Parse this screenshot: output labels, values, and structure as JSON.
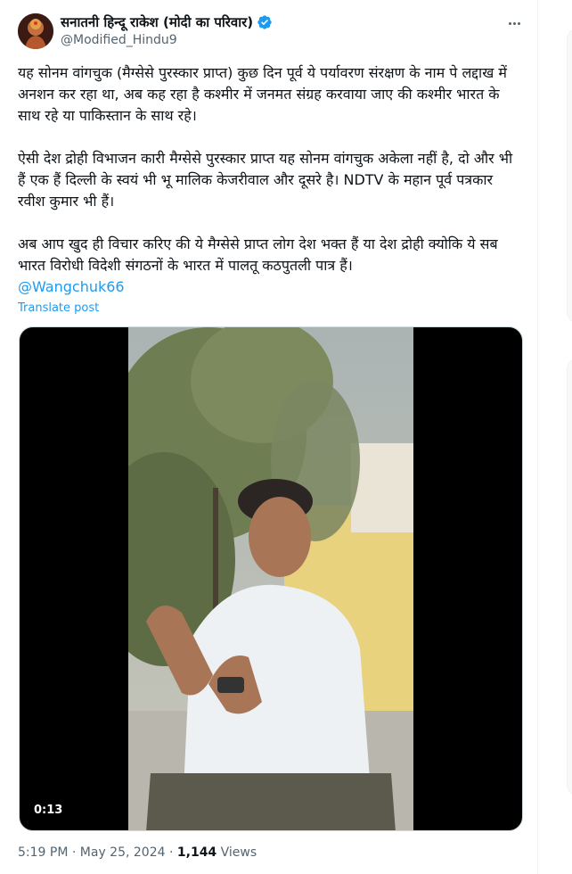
{
  "post": {
    "author": {
      "display_name": "सनातनी हिन्दू राकेश (मोदी का परिवार)",
      "handle": "@Modified_Hindu9",
      "verified": true,
      "avatar_icon": "avatar-image"
    },
    "more_icon": "more-options-icon",
    "paragraphs": [
      "यह सोनम वांगचुक (मैग्सेसे पुरस्कार प्राप्त) कुछ दिन पूर्व ये पर्यावरण संरक्षण के नाम पे लद्दाख में अनशन कर रहा था, अब कह रहा है कश्मीर में जनमत संग्रह करवाया जाए की कश्मीर भारत के साथ रहे या पाकिस्तान के साथ रहे।",
      "ऐसी देश द्रोही विभाजन कारी मैग्सेसे पुरस्कार प्राप्त यह सोनम वांगचुक अकेला नहीं है, दो और भी हैं एक हैं दिल्ली के स्वयं भी भू मालिक केजरीवाल और दूसरे है। NDTV के महान पूर्व पत्रकार रवीश कुमार भी हैं।",
      "अब आप खुद ही विचार करिए की ये मैग्सेसे प्राप्त लोग देश भक्त हैं या देश द्रोही क्योकि ये सब भारत विरोधी विदेशी संगठनों के भारत में पालतू कठपुतली पात्र हैं।"
    ],
    "mention": "@Wangchuk66",
    "translate_label": "Translate post",
    "video": {
      "duration": "0:13"
    },
    "time": "5:19 PM",
    "date": "May 25, 2024",
    "separator": "·",
    "views_count": "1,144",
    "views_label": "Views"
  },
  "colors": {
    "link": "#1d9bf0",
    "text": "#0f1419",
    "secondary": "#536471",
    "verified": "#1d9bf0"
  }
}
